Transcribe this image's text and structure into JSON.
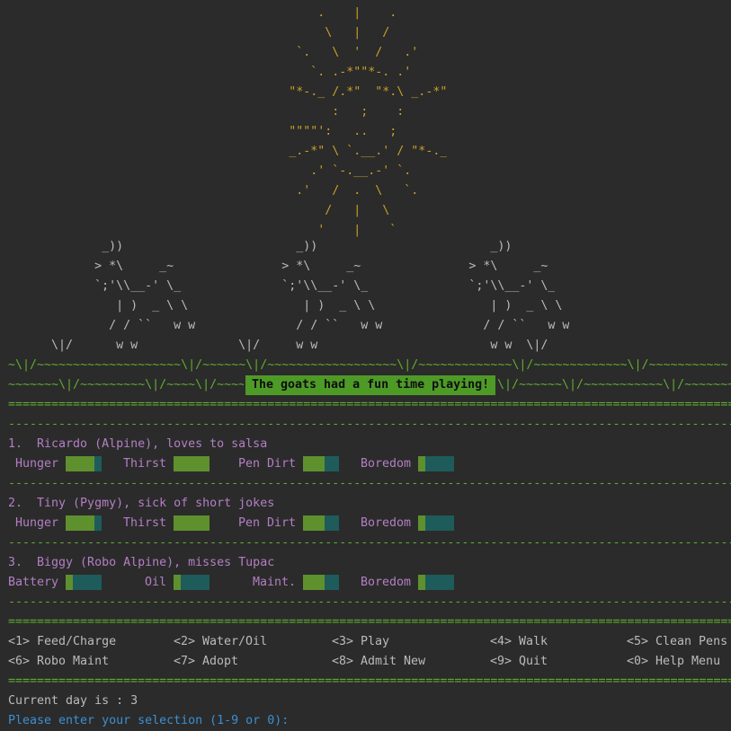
{
  "art": {
    "sun": [
      "                                           .    |    .",
      "                                            \\   |   /",
      "                                        `.   \\  '  /   .'",
      "                                          `. .-*\"\"*-. .'",
      "                                       \"*-._ /.*\"  \"*.\\ _.-*\"",
      "                                             :   ;    :",
      "                                       \"\"\"\"':   ..   ;",
      "                                       _.-*\" \\ `.__.' / \"*-._",
      "                                          .' `-.__.-' `.",
      "                                        .'   /  .  \\   `.",
      "                                            /   |   \\",
      "                                           '    |    `"
    ],
    "goats": [
      "             _))                        _))                        _))",
      "            > *\\     _~               > *\\     _~               > *\\     _~",
      "            `;'\\\\__-' \\_              `;'\\\\__-' \\_              `;'\\\\__-' \\_",
      "               | )  _ \\ \\                | )  _ \\ \\                | )  _ \\ \\",
      "              / / ``   w w              / / ``   w w              / / ``   w w",
      "      \\|/      w w              \\|/     w w                        w w  \\|/"
    ],
    "grass1": "~\\|/~~~~~~~~~~~~~~~~~~~~\\|/~~~~~~\\|/~~~~~~~~~~~~~~~~~~\\|/~~~~~~~~~~~~~\\|/~~~~~~~~~~~~~\\|/~~~~~~~~~~~",
    "grass2_left": "~~~~~~~\\|/~~~~~~~~~\\|/~~~~\\|/~~~~~",
    "grass2_right": "\\|/~~~~~~\\|/~~~~~~~~~~~\\|/~~~~~~~~~~"
  },
  "message": "The goats had a fun time playing!",
  "separator_double": "================================================================================================================",
  "separator_dash": "----------------------------------------------------------------------------------------------------------------",
  "goats": [
    {
      "title": "1.  Ricardo (Alpine), loves to salsa",
      "stats": [
        {
          "label": "Hunger",
          "level": 0.8
        },
        {
          "label": "Thirst",
          "level": 1.0
        },
        {
          "label": "Pen Dirt",
          "level": 0.6
        },
        {
          "label": "Boredom",
          "level": 0.2
        }
      ]
    },
    {
      "title": "2.  Tiny (Pygmy), sick of short jokes",
      "stats": [
        {
          "label": "Hunger",
          "level": 0.8
        },
        {
          "label": "Thirst",
          "level": 1.0
        },
        {
          "label": "Pen Dirt",
          "level": 0.6
        },
        {
          "label": "Boredom",
          "level": 0.2
        }
      ]
    },
    {
      "title": "3.  Biggy (Robo Alpine), misses Tupac",
      "stats": [
        {
          "label": "Battery",
          "level": 0.2
        },
        {
          "label": "Oil",
          "level": 0.2
        },
        {
          "label": "Maint.",
          "level": 0.6
        },
        {
          "label": "Boredom",
          "level": 0.2
        }
      ]
    }
  ],
  "menu": [
    [
      "<1> Feed/Charge",
      "<2> Water/Oil",
      "<3> Play",
      "<4> Walk",
      "<5> Clean Pens"
    ],
    [
      "<6> Robo Maint",
      "<7> Adopt",
      "<8> Admit New",
      "<9> Quit",
      "<0> Help Menu"
    ]
  ],
  "status": "Current day is : 3",
  "prompt": "Please enter your selection (1-9 or 0):",
  "colors": {
    "background": "#2b2b2b",
    "sun": "#c8a028",
    "grass": "#5fae2f",
    "label": "#b37fc4",
    "prompt": "#3d8fd1",
    "message_bg": "#4e9a27",
    "bar_fill": "#6aa033",
    "bar_empty": "#206664"
  }
}
